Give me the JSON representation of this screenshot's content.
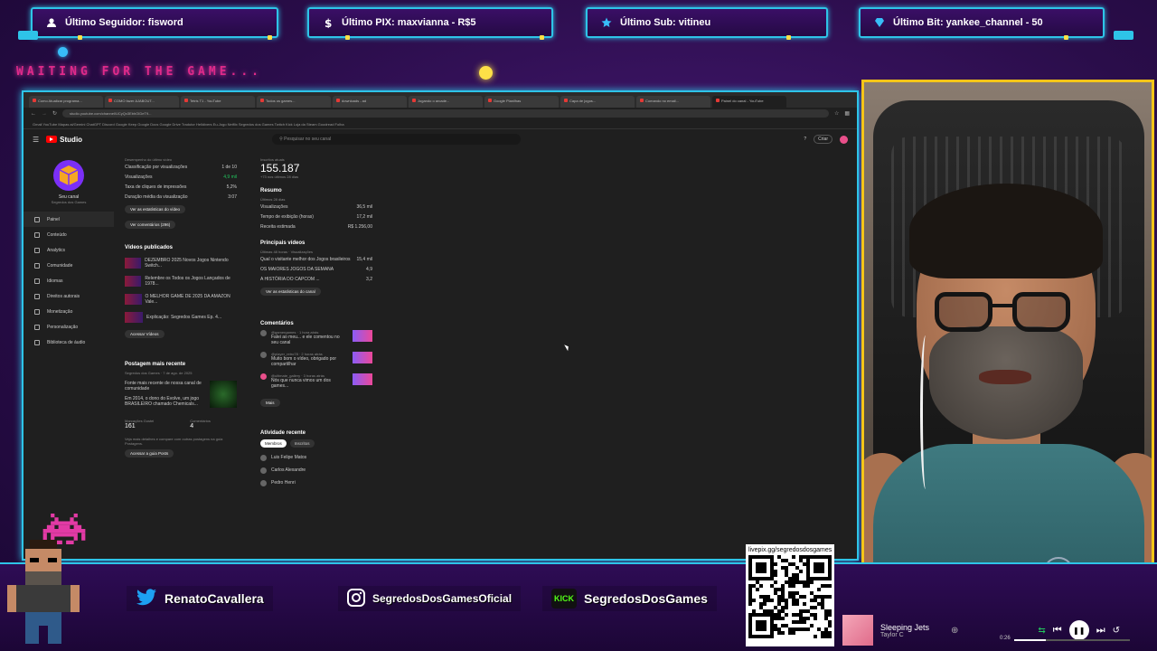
{
  "alerts": [
    {
      "label": "Último Seguidor: fisword",
      "icon": "user-icon"
    },
    {
      "label": "Último PIX: maxvianna - R$5",
      "icon": "dollar-icon"
    },
    {
      "label": "Último Sub: vitineu",
      "icon": "star-icon"
    },
    {
      "label": "Último Bit: yankee_channel - 50",
      "icon": "diamond-icon"
    }
  ],
  "waiting_text": "WAITING FOR THE GAME...",
  "browser": {
    "url": "studio.youtube.com/channel/UCyQx3EbhOIDeT9...",
    "tabs": [
      "Como Atualizar programa...",
      "COMO fazer AJABOUT...",
      "Tetris T1 - YouTube",
      "Todos os games...",
      "downloads - ad",
      "Jogando o arcade...",
      "Google Planilhas",
      "Capa de jogos...",
      "Comando no email...",
      "Painel do canal - YouTube"
    ],
    "bookmarks": "Gmail   YouTube   Mapas   ai/Gemini   ChatGPT   Discord   Google Keep   Google Docs   Google Drive   Tradutor   Helldivers   Eu-Jogo   Netflix   Segredos dos Games   Twitch   Kick   Loja da Steam   Goodread   Folha"
  },
  "youtube": {
    "brand": "Studio",
    "search_placeholder": "Pesquisar no seu canal",
    "create": "Criar",
    "channel_name": "Seu canal",
    "channel_sub": "Segredos dos Games",
    "sidebar": [
      "Painel",
      "Conteúdo",
      "Analytics",
      "Comunidade",
      "Idiomas",
      "Direitos autorais",
      "Monetização",
      "Personalização",
      "Biblioteca de áudio"
    ],
    "left": {
      "title": "Desempenho do último vídeo",
      "stats": [
        {
          "k": "Classificação por visualizações",
          "v": "1 de 10"
        },
        {
          "k": "Visualizações",
          "v": "4,9 mil"
        },
        {
          "k": "Taxa de cliques de impressões",
          "v": "5,2%"
        },
        {
          "k": "Duração média da visualização",
          "v": "3:07"
        }
      ],
      "btn1": "Ver as estatísticas do vídeo",
      "btn2": "Ver comentários (296)",
      "published_title": "Vídeos publicados",
      "videos": [
        "DEZEMBRO 2025 Novos Jogos Nintendo Switch...",
        "Relembre os Todos os Jogos Lançados de 1978...",
        "O MELHOR GAME DE 2025 DA AMAZON Vale...",
        "Explicação: Segredos Games Ep. 4..."
      ],
      "btn3": "Acessar Vídeos",
      "post_title": "Postagem mais recente",
      "post_author": "Segredos dos Games",
      "post_date": "7 de ago. de 2025",
      "post_text1": "Fonte mais recente de nossa canal de comunidade",
      "post_text2": "Em 2014, o dono do Evolve, um jogo BRASILEIRO chamado Chemicals...",
      "likes_label": "Marcações Gostei",
      "likes": "161",
      "comments_label": "Comentários",
      "comments": "4",
      "post_note": "Veja mais detalhes e compare com outras postagens na guia Postagens.",
      "btn4": "Acessar a guia Posts"
    },
    "mid": {
      "subs_label": "Inscritos atuais",
      "subs": "155.187",
      "subs_delta": "+73 nos últimos 28 dias",
      "summary_title": "Resumo",
      "summary_sub": "Últimos 28 dias",
      "summary": [
        {
          "k": "Visualizações",
          "v": "36,5 mil"
        },
        {
          "k": "Tempo de exibição (horas)",
          "v": "17,2 mil"
        },
        {
          "k": "Receita estimada",
          "v": "R$ 1.256,00"
        }
      ],
      "top_title": "Principais vídeos",
      "top_sub": "Últimas 48 horas · Visualizações",
      "top": [
        {
          "k": "Qual o visitante melhor dos Jogos brasileiros",
          "v": "15,4 mil"
        },
        {
          "k": "OS MAIORES JOGOS DA SEMANA",
          "v": "4,9"
        },
        {
          "k": "A HISTÓRIA DO CAPCOM ...",
          "v": "3,2"
        }
      ],
      "btn_stats": "Ver as estatísticas do canal",
      "comments_title": "Comentários",
      "comments": [
        {
          "user": "@gamergames",
          "time": "1 hora atrás",
          "text": "Falei ao meu... e ele comentou no seu canal"
        },
        {
          "user": "@player_retro78",
          "time": "2 horas atrás",
          "text": "Muito bom o vídeo, obrigado por compartilhar"
        },
        {
          "user": "@ultimate_gallery",
          "time": "3 horas atrás",
          "text": "Nós que nunca vimos um dos games..."
        }
      ],
      "more": "Mais",
      "activity_title": "Atividade recente",
      "activity_tabs": [
        "Membros",
        "Inscritos"
      ],
      "activity": [
        "Luis Felipe Matos",
        "Carlos Alexandre",
        "Pedro Henri"
      ]
    }
  },
  "socials": [
    {
      "label": "RenatoCavallera",
      "icon": "twitter-icon"
    },
    {
      "label": "SegredosDosGamesOficial",
      "icon": "instagram-icon"
    },
    {
      "label": "SegredosDosGames",
      "icon": "kick-icon",
      "badge": "KICK"
    }
  ],
  "qr_url": "livepix.gg/segredosdosgames",
  "music": {
    "title": "Sleeping Jets",
    "artist": "Taylor C",
    "time": "0:26",
    "progress": 0.27
  },
  "colors": {
    "accent": "#2ec4e8",
    "cam_border": "#f5c518",
    "waiting": "#e02a8a"
  }
}
